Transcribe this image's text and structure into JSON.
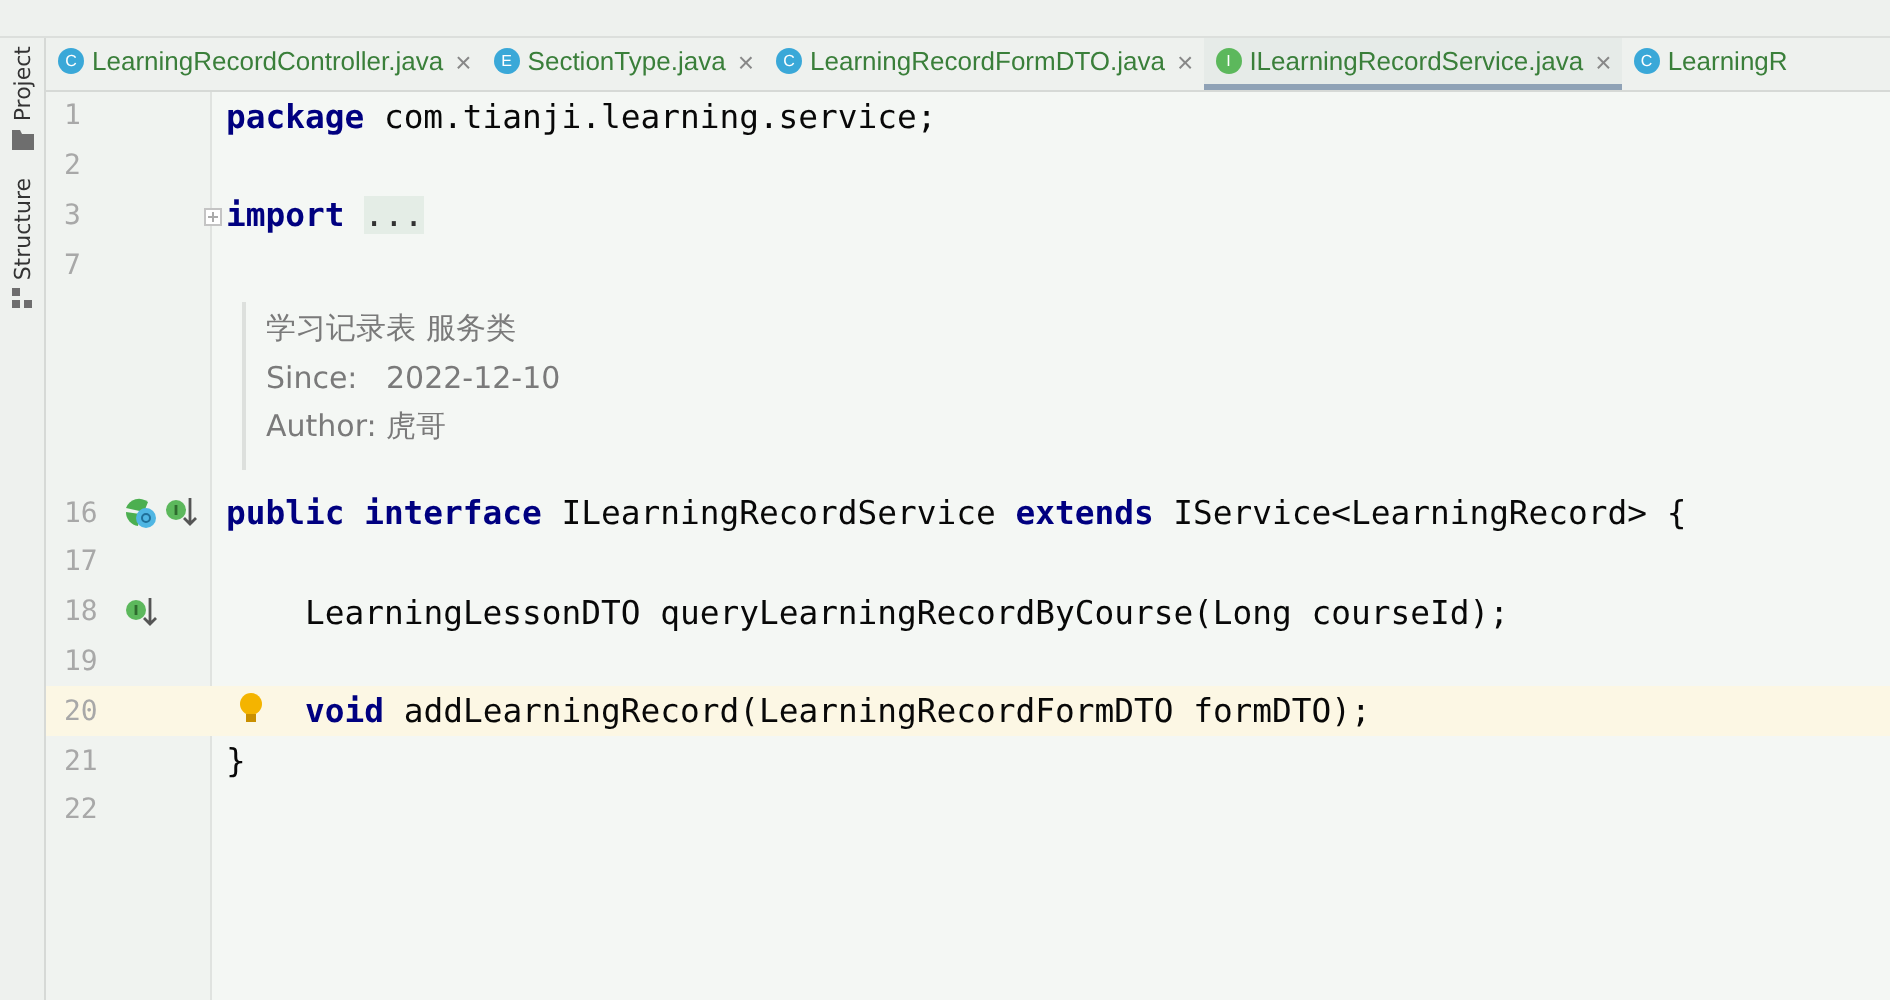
{
  "side_tools": [
    {
      "label": "Project",
      "kind": "folder"
    },
    {
      "label": "Structure",
      "kind": "structure"
    }
  ],
  "tabs": [
    {
      "icon": "C",
      "color": "#3aa8d8",
      "label": "LearningRecordController.java",
      "selected": false,
      "close": "×"
    },
    {
      "icon": "E",
      "color": "#3aa8d8",
      "label": "SectionType.java",
      "selected": false,
      "close": "×"
    },
    {
      "icon": "C",
      "color": "#3aa8d8",
      "label": "LearningRecordFormDTO.java",
      "selected": false,
      "close": "×"
    },
    {
      "icon": "I",
      "color": "#5cb85c",
      "label": "ILearningRecordService.java",
      "selected": true,
      "close": "×"
    },
    {
      "icon": "C",
      "color": "#3aa8d8",
      "label": "LearningR",
      "selected": false
    }
  ],
  "editor": {
    "lines": [
      {
        "kind": "code",
        "number": "1",
        "tokens": [
          {
            "kind": "keyword",
            "text": "package"
          },
          {
            "kind": "plain",
            "text": " com.tianji.learning.service;"
          }
        ]
      },
      {
        "kind": "code",
        "number": "2"
      },
      {
        "kind": "code",
        "number": "3",
        "folded": true,
        "tokens": [
          {
            "kind": "keyword",
            "text": "import "
          },
          {
            "kind": "fold",
            "text": "..."
          }
        ]
      },
      {
        "kind": "code",
        "number": "7"
      },
      {
        "kind": "doc",
        "paragraphs": [
          {
            "text": "学习记录表 服务类"
          },
          {
            "label": "Since:",
            "value": "2022-12-10"
          },
          {
            "label": "Author:",
            "value": "虎哥"
          }
        ]
      },
      {
        "kind": "code",
        "number": "16",
        "has_implementations": true,
        "implements_parent": true,
        "tokens": [
          {
            "kind": "keyword",
            "text": "public interface"
          },
          {
            "kind": "plain",
            "text": " ILearningRecordService "
          },
          {
            "kind": "keyword",
            "text": "extends"
          },
          {
            "kind": "plain",
            "text": " IService<LearningRecord> {"
          }
        ]
      },
      {
        "kind": "code",
        "number": "17"
      },
      {
        "kind": "code",
        "number": "18",
        "implements_parent": true,
        "indented": true,
        "tokens": [
          {
            "kind": "plain",
            "text": "LearningLessonDTO queryLearningRecordByCourse(Long courseId);"
          }
        ]
      },
      {
        "kind": "code",
        "number": "19"
      },
      {
        "kind": "code",
        "number": "20",
        "current": true,
        "bulb": true,
        "indented": true,
        "tokens": [
          {
            "kind": "keyword",
            "text": "void"
          },
          {
            "kind": "plain",
            "text": " addLearningRecord(LearningRecordFormDTO formDTO);"
          }
        ]
      },
      {
        "kind": "code",
        "number": "21",
        "tokens": [
          {
            "kind": "plain",
            "text": "}"
          }
        ]
      },
      {
        "kind": "code",
        "number": "22"
      }
    ]
  }
}
